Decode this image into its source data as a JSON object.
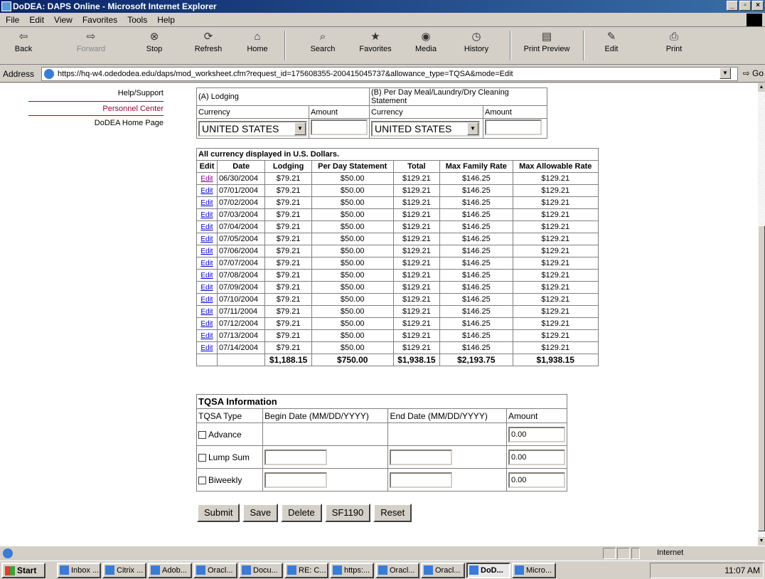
{
  "window": {
    "title": "DoDEA: DAPS Online - Microsoft Internet Explorer"
  },
  "menu": [
    "File",
    "Edit",
    "View",
    "Favorites",
    "Tools",
    "Help"
  ],
  "toolbar": {
    "back": "Back",
    "forward": "Forward",
    "stop": "Stop",
    "refresh": "Refresh",
    "home": "Home",
    "search": "Search",
    "favorites": "Favorites",
    "media": "Media",
    "history": "History",
    "print_preview": "Print Preview",
    "edit": "Edit",
    "print": "Print"
  },
  "address": {
    "label": "Address",
    "url": "https://hq-w4.odedodea.edu/daps/mod_worksheet.cfm?request_id=175608355-200415045737&allowance_type=TQSA&mode=Edit",
    "go": "Go"
  },
  "sidebar": [
    "Help/Support",
    "Personnel Center",
    "DoDEA Home Page"
  ],
  "lodging": {
    "a_header": "(A) Lodging",
    "b_header": "(B) Per Day Meal/Laundry/Dry Cleaning Statement",
    "currency_label": "Currency",
    "amount_label": "Amount",
    "currency_a": "UNITED STATES",
    "currency_b": "UNITED STATES"
  },
  "daily": {
    "caption": "All currency displayed in U.S. Dollars.",
    "headers": [
      "Edit",
      "Date",
      "Lodging",
      "Per Day Statement",
      "Total",
      "Max Family Rate",
      "Max Allowable Rate"
    ],
    "edit_label": "Edit",
    "rows": [
      [
        "06/30/2004",
        "$79.21",
        "$50.00",
        "$129.21",
        "$146.25",
        "$129.21"
      ],
      [
        "07/01/2004",
        "$79.21",
        "$50.00",
        "$129.21",
        "$146.25",
        "$129.21"
      ],
      [
        "07/02/2004",
        "$79.21",
        "$50.00",
        "$129.21",
        "$146.25",
        "$129.21"
      ],
      [
        "07/03/2004",
        "$79.21",
        "$50.00",
        "$129.21",
        "$146.25",
        "$129.21"
      ],
      [
        "07/04/2004",
        "$79.21",
        "$50.00",
        "$129.21",
        "$146.25",
        "$129.21"
      ],
      [
        "07/05/2004",
        "$79.21",
        "$50.00",
        "$129.21",
        "$146.25",
        "$129.21"
      ],
      [
        "07/06/2004",
        "$79.21",
        "$50.00",
        "$129.21",
        "$146.25",
        "$129.21"
      ],
      [
        "07/07/2004",
        "$79.21",
        "$50.00",
        "$129.21",
        "$146.25",
        "$129.21"
      ],
      [
        "07/08/2004",
        "$79.21",
        "$50.00",
        "$129.21",
        "$146.25",
        "$129.21"
      ],
      [
        "07/09/2004",
        "$79.21",
        "$50.00",
        "$129.21",
        "$146.25",
        "$129.21"
      ],
      [
        "07/10/2004",
        "$79.21",
        "$50.00",
        "$129.21",
        "$146.25",
        "$129.21"
      ],
      [
        "07/11/2004",
        "$79.21",
        "$50.00",
        "$129.21",
        "$146.25",
        "$129.21"
      ],
      [
        "07/12/2004",
        "$79.21",
        "$50.00",
        "$129.21",
        "$146.25",
        "$129.21"
      ],
      [
        "07/13/2004",
        "$79.21",
        "$50.00",
        "$129.21",
        "$146.25",
        "$129.21"
      ],
      [
        "07/14/2004",
        "$79.21",
        "$50.00",
        "$129.21",
        "$146.25",
        "$129.21"
      ]
    ],
    "totals": [
      "$1,188.15",
      "$750.00",
      "$1,938.15",
      "$2,193.75",
      "$1,938.15"
    ]
  },
  "tqsa": {
    "title": "TQSA Information",
    "headers": [
      "TQSA Type",
      "Begin Date (MM/DD/YYYY)",
      "End Date (MM/DD/YYYY)",
      "Amount"
    ],
    "rows": [
      {
        "type": "Advance",
        "amount": "0.00"
      },
      {
        "type": "Lump Sum",
        "amount": "0.00"
      },
      {
        "type": "Biweekly",
        "amount": "0.00"
      }
    ]
  },
  "buttons": [
    "Submit",
    "Save",
    "Delete",
    "SF1190",
    "Reset"
  ],
  "status": {
    "zone": "Internet"
  },
  "taskbar": {
    "start": "Start",
    "tasks": [
      "Inbox ...",
      "Citrix ...",
      "Adob...",
      "Oracl...",
      "Docu...",
      "RE: C...",
      "https:...",
      "Oracl...",
      "Oracl...",
      "DoD...",
      "Micro..."
    ],
    "clock": "11:07 AM"
  }
}
